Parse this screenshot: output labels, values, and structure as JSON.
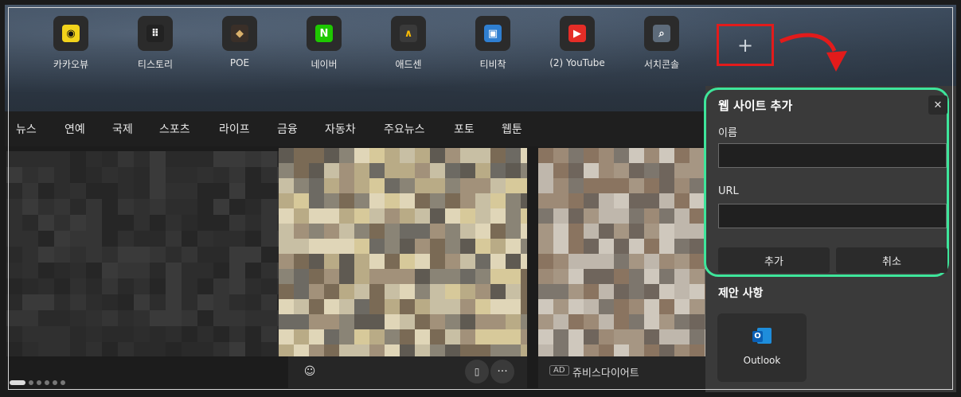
{
  "shortcuts": [
    {
      "label": "카카오뷰",
      "icon": "kakaoview-icon",
      "bg": "#f2d31b",
      "fg": "#111111",
      "glyph": "◉"
    },
    {
      "label": "티스토리",
      "icon": "tistory-icon",
      "bg": "#222222",
      "fg": "#ffffff",
      "glyph": "⠿"
    },
    {
      "label": "POE",
      "icon": "poe-icon",
      "bg": "#3a2f28",
      "fg": "#d9b06b",
      "glyph": "◆"
    },
    {
      "label": "네이버",
      "icon": "naver-icon",
      "bg": "#1ec800",
      "fg": "#ffffff",
      "glyph": "N"
    },
    {
      "label": "애드센",
      "icon": "adsense-icon",
      "bg": "#3a3a3a",
      "fg": "#fbbc04",
      "glyph": "∧"
    },
    {
      "label": "티비착",
      "icon": "tv-icon",
      "bg": "#2f7fd1",
      "fg": "#ffffff",
      "glyph": "▣"
    },
    {
      "label": "(2) YouTube",
      "icon": "youtube-icon",
      "bg": "#e52d27",
      "fg": "#ffffff",
      "glyph": "▶"
    },
    {
      "label": "서치콘솔",
      "icon": "search-console-icon",
      "bg": "#5d6b7a",
      "fg": "#ffffff",
      "glyph": "⌕"
    }
  ],
  "add_tile": {
    "glyph": "+"
  },
  "nav": [
    "뉴스",
    "연예",
    "국제",
    "스포츠",
    "라이프",
    "금융",
    "자동차",
    "주요뉴스",
    "포토",
    "웹툰"
  ],
  "dialog": {
    "title": "웹 사이트 추가",
    "close_glyph": "✕",
    "name_label": "이름",
    "name_value": "",
    "url_label": "URL",
    "url_value": "",
    "add_button": "추가",
    "cancel_button": "취소"
  },
  "suggestions": {
    "title": "제안 사항",
    "items": [
      {
        "label": "Outlook",
        "icon": "outlook-icon"
      }
    ]
  },
  "cards": {
    "ad_badge": "AD",
    "ad_source": "쥬비스다이어트",
    "bookmark_glyph": "🔖",
    "more_glyph": "···",
    "react_glyph": "☺"
  },
  "colors": {
    "highlight_red": "#e21b1b",
    "highlight_green": "#3ee59b",
    "panel": "#3a3a3a"
  }
}
